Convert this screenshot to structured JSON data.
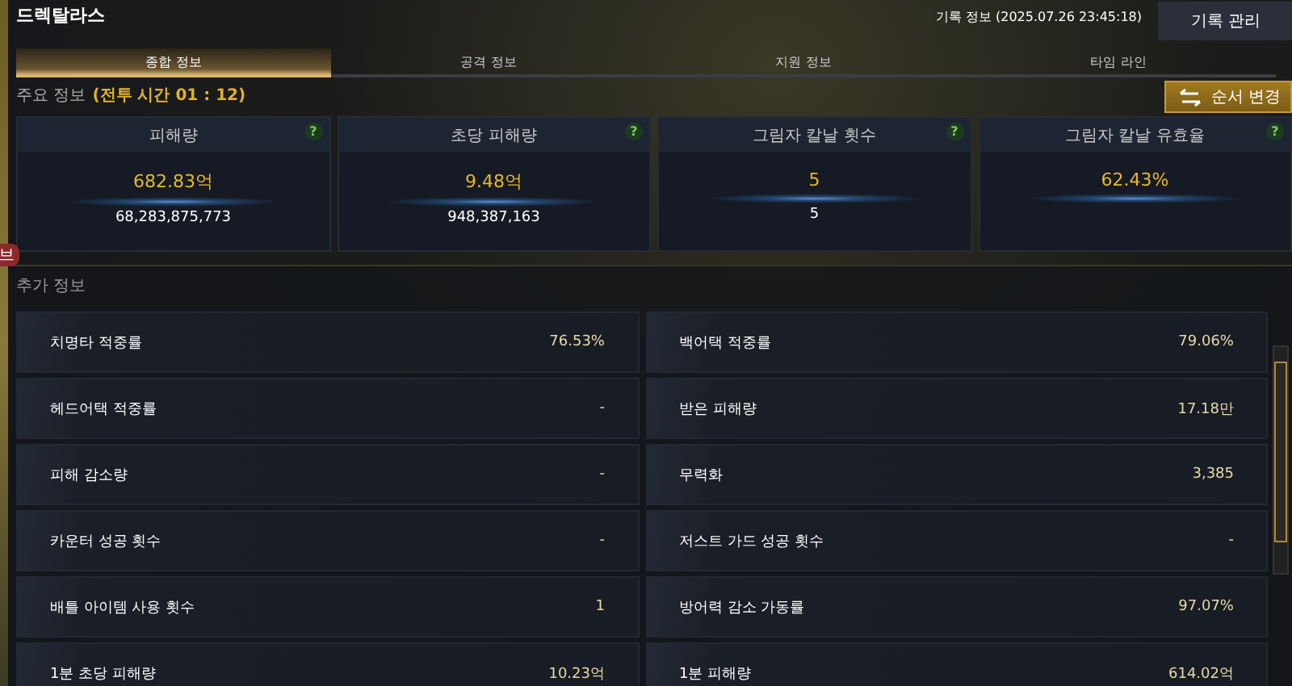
{
  "window": {
    "title": "드렉탈라스"
  },
  "record": {
    "info": "기록 정보 (2025.07.26 23:45:18)",
    "button": "기록 관리"
  },
  "tabs": [
    {
      "label": "종합 정보",
      "selected": true
    },
    {
      "label": "공격 정보",
      "selected": false
    },
    {
      "label": "지원 정보",
      "selected": false
    },
    {
      "label": "타임 라인",
      "selected": false
    }
  ],
  "side_badge": "브",
  "main_section": {
    "title": "주요 정보",
    "battle_time": "(전투 시간 01 : 12)",
    "reorder_button": "순서 변경"
  },
  "cards": [
    {
      "title": "피해량",
      "value": "682.83억",
      "detail": "68,283,875,773",
      "help": "?"
    },
    {
      "title": "초당 피해량",
      "value": "9.48억",
      "detail": "948,387,163",
      "help": "?"
    },
    {
      "title": "그림자 칼날 횟수",
      "value": "5",
      "detail": "5",
      "help": "?"
    },
    {
      "title": "그림자 칼날 유효율",
      "value": "62.43%",
      "help": "?"
    }
  ],
  "extra_section": {
    "title": "추가 정보"
  },
  "stats": [
    {
      "label": "치명타 적중률",
      "value": "76.53%"
    },
    {
      "label": "백어택 적중률",
      "value": "79.06%"
    },
    {
      "label": "헤드어택 적중률",
      "value": "-"
    },
    {
      "label": "받은 피해량",
      "value": "17.18만"
    },
    {
      "label": "피해 감소량",
      "value": "-"
    },
    {
      "label": "무력화",
      "value": "3,385"
    },
    {
      "label": "카운터 성공 횟수",
      "value": "-"
    },
    {
      "label": "저스트 가드 성공 횟수",
      "value": "-"
    },
    {
      "label": "배틀 아이템 사용 횟수",
      "value": "1"
    },
    {
      "label": "방어력 감소 가동률",
      "value": "97.07%"
    },
    {
      "label": "1분 초당 피해량",
      "value": "10.23억"
    },
    {
      "label": "1분 피해량",
      "value": "614.02억"
    }
  ]
}
